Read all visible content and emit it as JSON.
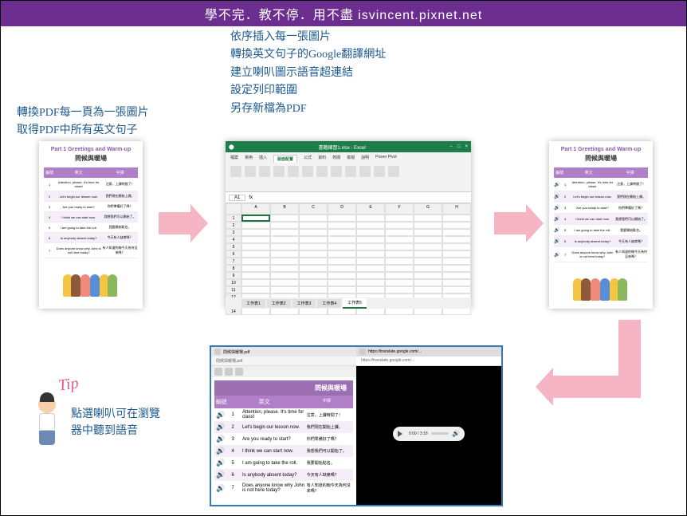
{
  "header": "學不完．教不停．用不盡 isvincent.pixnet.net",
  "annotations": {
    "left": {
      "l1": "轉換PDF每一頁為一張圖片",
      "l2": "取得PDF中所有英文句子"
    },
    "mid": {
      "l1": "依序插入每一張圖片",
      "l2": "轉換英文句子的Google翻譯網址",
      "l3": "建立喇叭圖示語音超連結",
      "l4": "設定列印範圍",
      "l5": "另存新檔為PDF"
    }
  },
  "pdf": {
    "title": "Part 1  Greetings and Warm-up",
    "subtitle": "問候與暖場",
    "headers": {
      "c1": "編號",
      "c2": "英文",
      "c3": "中譯"
    },
    "rows": [
      {
        "n": "1",
        "en": "Attention, please. It's time for class!",
        "zh": "注意，上課時間了！"
      },
      {
        "n": "2",
        "en": "Let's begin our lesson now.",
        "zh": "我們現在開始上課。"
      },
      {
        "n": "3",
        "en": "Are you ready to start?",
        "zh": "你們準備好了嗎？"
      },
      {
        "n": "4",
        "en": "I think we can start now.",
        "zh": "我想我們可以開始了。"
      },
      {
        "n": "5",
        "en": "I am going to take the roll.",
        "zh": "我要開始點名。"
      },
      {
        "n": "6",
        "en": "Is anybody absent today?",
        "zh": "今天有人缺席嗎？"
      },
      {
        "n": "7",
        "en": "Does anyone know why John is not here today?",
        "zh": "有人知道約翰今天為何沒來嗎？"
      }
    ]
  },
  "excel": {
    "title": "書籍練習1.xlsx - Excel",
    "tabs": [
      "檔案",
      "常用",
      "插入",
      "版面配置",
      "公式",
      "資料",
      "校閱",
      "檢視",
      "說明",
      "Power Pivot"
    ],
    "activeTab": "版面配置",
    "cellref": "A1",
    "fx": "fx",
    "cols": [
      "A",
      "B",
      "C",
      "D",
      "E",
      "F",
      "G",
      "H"
    ],
    "sheets": [
      "工作表1",
      "工作表2",
      "工作表3",
      "工作表4",
      "工作表5"
    ],
    "activeSheet": "工作表5"
  },
  "browser": {
    "leftUrl": "問候與暖場.pdf",
    "rightUrl": "https://translate.google.com/...",
    "bigTitle": "問候與暖場",
    "audio": {
      "time": "0:00 / 3:18"
    }
  },
  "tip": {
    "label": "Tip",
    "text1": "點選喇叭可在瀏覽",
    "text2": "器中聽到語音"
  }
}
